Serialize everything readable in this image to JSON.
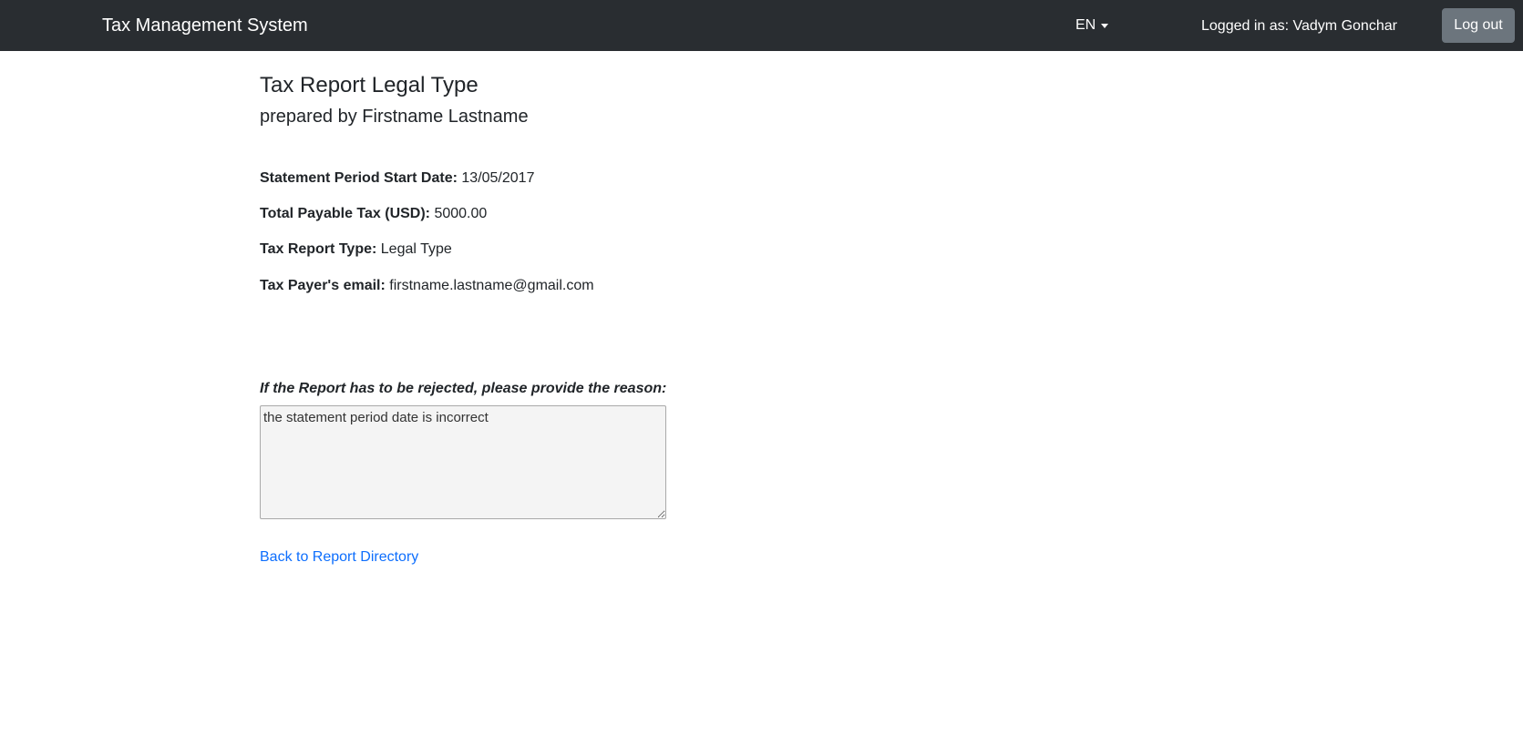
{
  "navbar": {
    "brand": "Tax Management System",
    "language": "EN",
    "user_label": "Logged in as: Vadym Gonchar",
    "logout_label": "Log out"
  },
  "report": {
    "title": "Tax Report Legal Type",
    "subtitle": "prepared by Firstname Lastname",
    "fields": [
      {
        "label": "Statement Period Start Date:",
        "value": "13/05/2017"
      },
      {
        "label": "Total Payable Tax (USD):",
        "value": "5000.00"
      },
      {
        "label": "Tax Report Type:",
        "value": "Legal Type"
      },
      {
        "label": "Tax Payer's email:",
        "value": "firstname.lastname@gmail.com"
      }
    ],
    "reject_prompt": "If the Report has to be rejected, please provide the reason:",
    "reject_reason": "the statement period date is incorrect",
    "back_link": "Back to Report Directory"
  },
  "colors": {
    "navbar_bg": "#292d31",
    "logout_bg": "#6c757d",
    "link": "#0d6efd"
  }
}
